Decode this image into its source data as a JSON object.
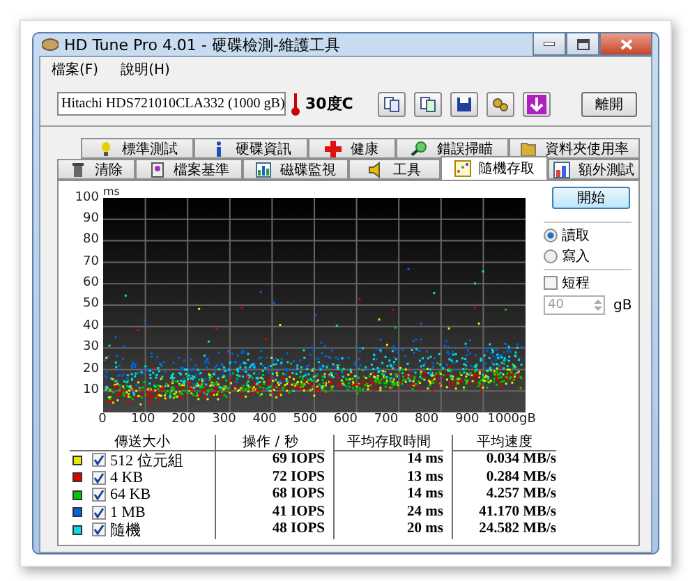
{
  "window": {
    "title": "HD Tune Pro 4.01 - 硬碟檢測-維護工具"
  },
  "menu": [
    "檔案(F)",
    "說明(H)"
  ],
  "toolbar": {
    "drive": "Hitachi HDS721010CLA332  (1000 gB)",
    "temperature": "30度C",
    "exit_button": "離開"
  },
  "tabs": [
    [
      {
        "label": "標準測試",
        "selected": false
      },
      {
        "label": "硬碟資訊",
        "selected": false
      },
      {
        "label": "健康",
        "selected": false
      },
      {
        "label": "錯誤掃瞄",
        "selected": false
      },
      {
        "label": "資料夾使用率",
        "selected": false
      }
    ],
    [
      {
        "label": "清除",
        "selected": false
      },
      {
        "label": "檔案基準",
        "selected": false
      },
      {
        "label": "磁碟監視",
        "selected": false
      },
      {
        "label": "工具",
        "selected": false
      },
      {
        "label": "隨機存取",
        "selected": true
      },
      {
        "label": "額外測試",
        "selected": false
      }
    ]
  ],
  "chart": {
    "y_unit": "ms",
    "y_ticks": [
      "100",
      "90",
      "80",
      "70",
      "60",
      "50",
      "40",
      "30",
      "20",
      "10"
    ],
    "x_ticks": [
      "0",
      "100",
      "200",
      "300",
      "400",
      "500",
      "600",
      "700",
      "800",
      "900",
      "1000gB"
    ]
  },
  "side": {
    "start_button": "開始",
    "modes": [
      {
        "label": "讀取",
        "selected": true
      },
      {
        "label": "寫入",
        "selected": false
      }
    ],
    "short_stroke": {
      "label": "短程",
      "checked": false
    },
    "size": "40",
    "unit": "gB"
  },
  "results": {
    "columns": [
      "傳送大小",
      "操作 / 秒",
      "平均存取時間",
      "平均速度"
    ],
    "rows": [
      {
        "size": "512 位元組",
        "color": "#e8e800",
        "checked": true,
        "ops": "69 IOPS",
        "time": "14 ms",
        "speed": "0.034 MB/s"
      },
      {
        "size": "4 KB",
        "color": "#e00000",
        "checked": true,
        "ops": "72 IOPS",
        "time": "13 ms",
        "speed": "0.284 MB/s"
      },
      {
        "size": "64 KB",
        "color": "#00c800",
        "checked": true,
        "ops": "68 IOPS",
        "time": "14 ms",
        "speed": "4.257 MB/s"
      },
      {
        "size": "1 MB",
        "color": "#0064dc",
        "checked": true,
        "ops": "41 IOPS",
        "time": "24 ms",
        "speed": "41.170 MB/s"
      },
      {
        "size": "隨機",
        "color": "#00e0e0",
        "checked": true,
        "ops": "48 IOPS",
        "time": "20 ms",
        "speed": "24.582 MB/s"
      }
    ]
  }
}
